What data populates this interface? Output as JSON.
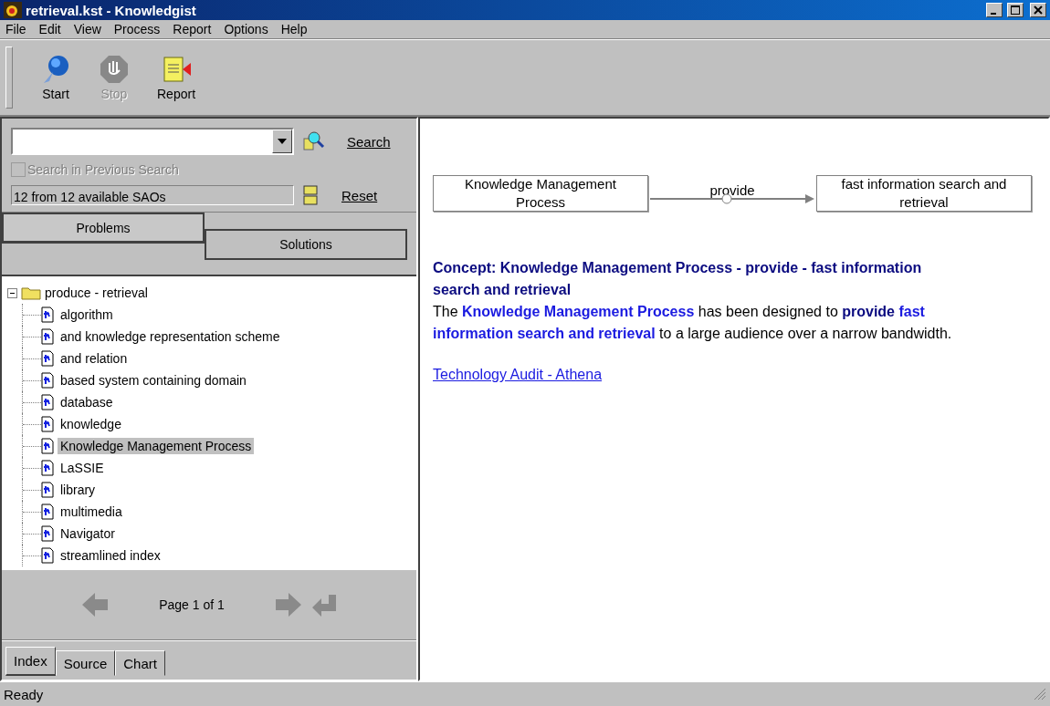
{
  "window": {
    "title": "retrieval.kst - Knowledgist"
  },
  "menu": [
    "File",
    "Edit",
    "View",
    "Process",
    "Report",
    "Options",
    "Help"
  ],
  "toolbar": [
    {
      "label": "Start",
      "kind": "start",
      "disabled": false
    },
    {
      "label": "Stop",
      "kind": "stop",
      "disabled": true
    },
    {
      "label": "Report",
      "kind": "report",
      "disabled": false
    }
  ],
  "search": {
    "button": "Search",
    "checkbox": {
      "label": "Search in Previous Search",
      "checked": false,
      "disabled": true
    },
    "count": "12 from 12 available SAOs",
    "reset": "Reset"
  },
  "view_tabs": [
    {
      "label": "Problems",
      "selected": true
    },
    {
      "label": "Solutions",
      "selected": false
    }
  ],
  "tree": {
    "label": "produce - retrieval",
    "expanded": true,
    "children": [
      {
        "label": "algorithm",
        "selected": false
      },
      {
        "label": "and knowledge representation scheme",
        "selected": false
      },
      {
        "label": "and relation",
        "selected": false
      },
      {
        "label": "based system containing domain",
        "selected": false
      },
      {
        "label": "database",
        "selected": false
      },
      {
        "label": "knowledge",
        "selected": false
      },
      {
        "label": "Knowledge Management Process",
        "selected": true
      },
      {
        "label": "LaSSIE",
        "selected": false
      },
      {
        "label": "library",
        "selected": false
      },
      {
        "label": "multimedia",
        "selected": false
      },
      {
        "label": "Navigator",
        "selected": false
      },
      {
        "label": "streamlined index",
        "selected": false
      }
    ]
  },
  "pager": {
    "text": "Page 1 of 1"
  },
  "bottom_tabs": [
    {
      "label": "Index",
      "selected": true
    },
    {
      "label": "Source",
      "selected": false
    },
    {
      "label": "Chart",
      "selected": false
    }
  ],
  "diagram": {
    "subject": "Knowledge Management Process",
    "action": "provide",
    "object": "fast information search and retrieval"
  },
  "concept": {
    "title": "Concept: Knowledge Management Process - provide - fast information search and retrieval",
    "body": [
      {
        "kind": "plain",
        "text": " The "
      },
      {
        "kind": "term",
        "text": "Knowledge Management Process"
      },
      {
        "kind": "plain",
        "text": " has been designed to "
      },
      {
        "kind": "verb",
        "text": "provide"
      },
      {
        "kind": "term",
        "text": " fast information search and retrieval"
      },
      {
        "kind": "plain",
        "text": " to a large audience over a narrow bandwidth."
      }
    ],
    "link": "Technology Audit - Athena"
  },
  "status_bar": "Ready"
}
